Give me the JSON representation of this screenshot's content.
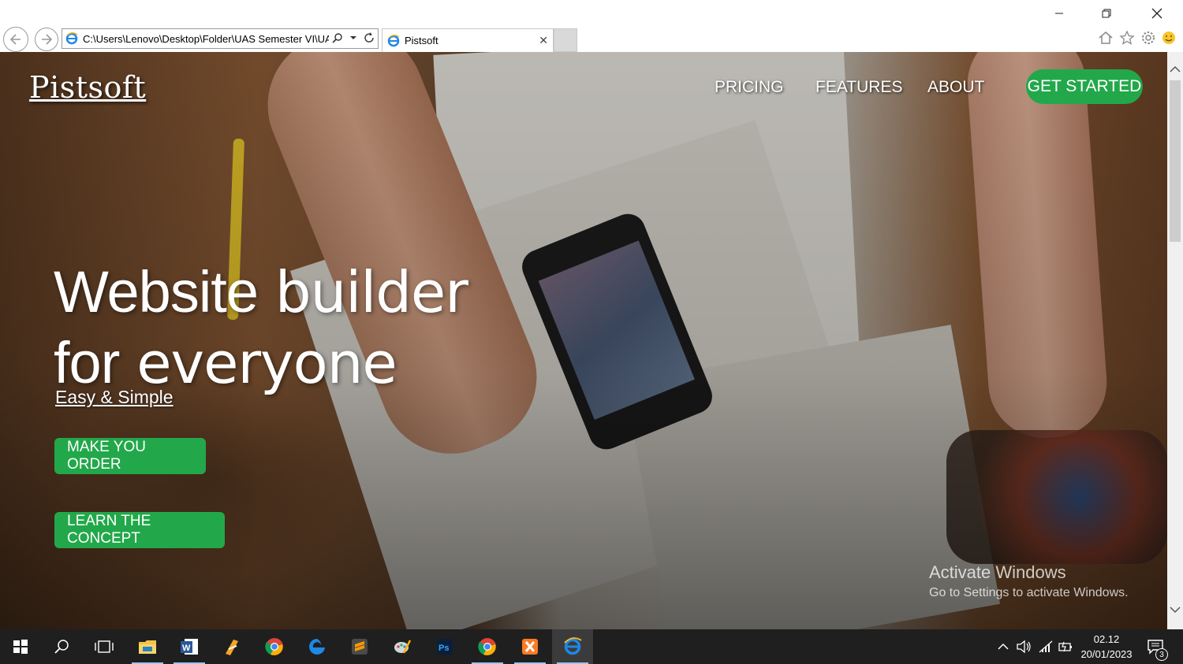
{
  "browser": {
    "address_url": "C:\\Users\\Lenovo\\Desktop\\Folder\\UAS Semester VI\\UA",
    "tab_title": "Pistsoft"
  },
  "page": {
    "logo": "Pistsoft",
    "menu": {
      "pricing": "PRICING",
      "features": "FEATURES",
      "about": "ABOUT"
    },
    "cta": "GET STARTED",
    "hero": {
      "line1_light": "Website",
      "line1_bold": "builder",
      "line2_light": "for",
      "line2_bold": "everyone",
      "subtitle": "Easy & Simple"
    },
    "buttons": {
      "order": "MAKE YOU ORDER",
      "concept": "LEARN THE CONCEPT"
    },
    "watermark": {
      "title": "Activate Windows",
      "subtitle": "Go to Settings to activate Windows."
    }
  },
  "taskbar": {
    "time": "02.12",
    "date": "20/01/2023",
    "notifications": "3"
  },
  "colors": {
    "accent_green": "#22a84a",
    "taskbar": "#1f1f1f",
    "ie_blue": "#1e88e5"
  },
  "icons": [
    "back-icon",
    "forward-icon",
    "ie-icon",
    "search-icon",
    "dropdown-icon",
    "refresh-icon",
    "close-icon",
    "home-icon",
    "star-icon",
    "gear-icon",
    "smiley-icon",
    "windows-start-icon",
    "taskbar-search-icon",
    "task-view-icon",
    "file-explorer-icon",
    "word-icon",
    "app-icon",
    "chrome-icon",
    "edge-icon",
    "sublime-icon",
    "paint-icon",
    "photoshop-icon",
    "xampp-icon",
    "internet-explorer-icon",
    "chevron-up-icon",
    "volume-icon",
    "network-icon",
    "battery-icon",
    "notification-icon"
  ]
}
